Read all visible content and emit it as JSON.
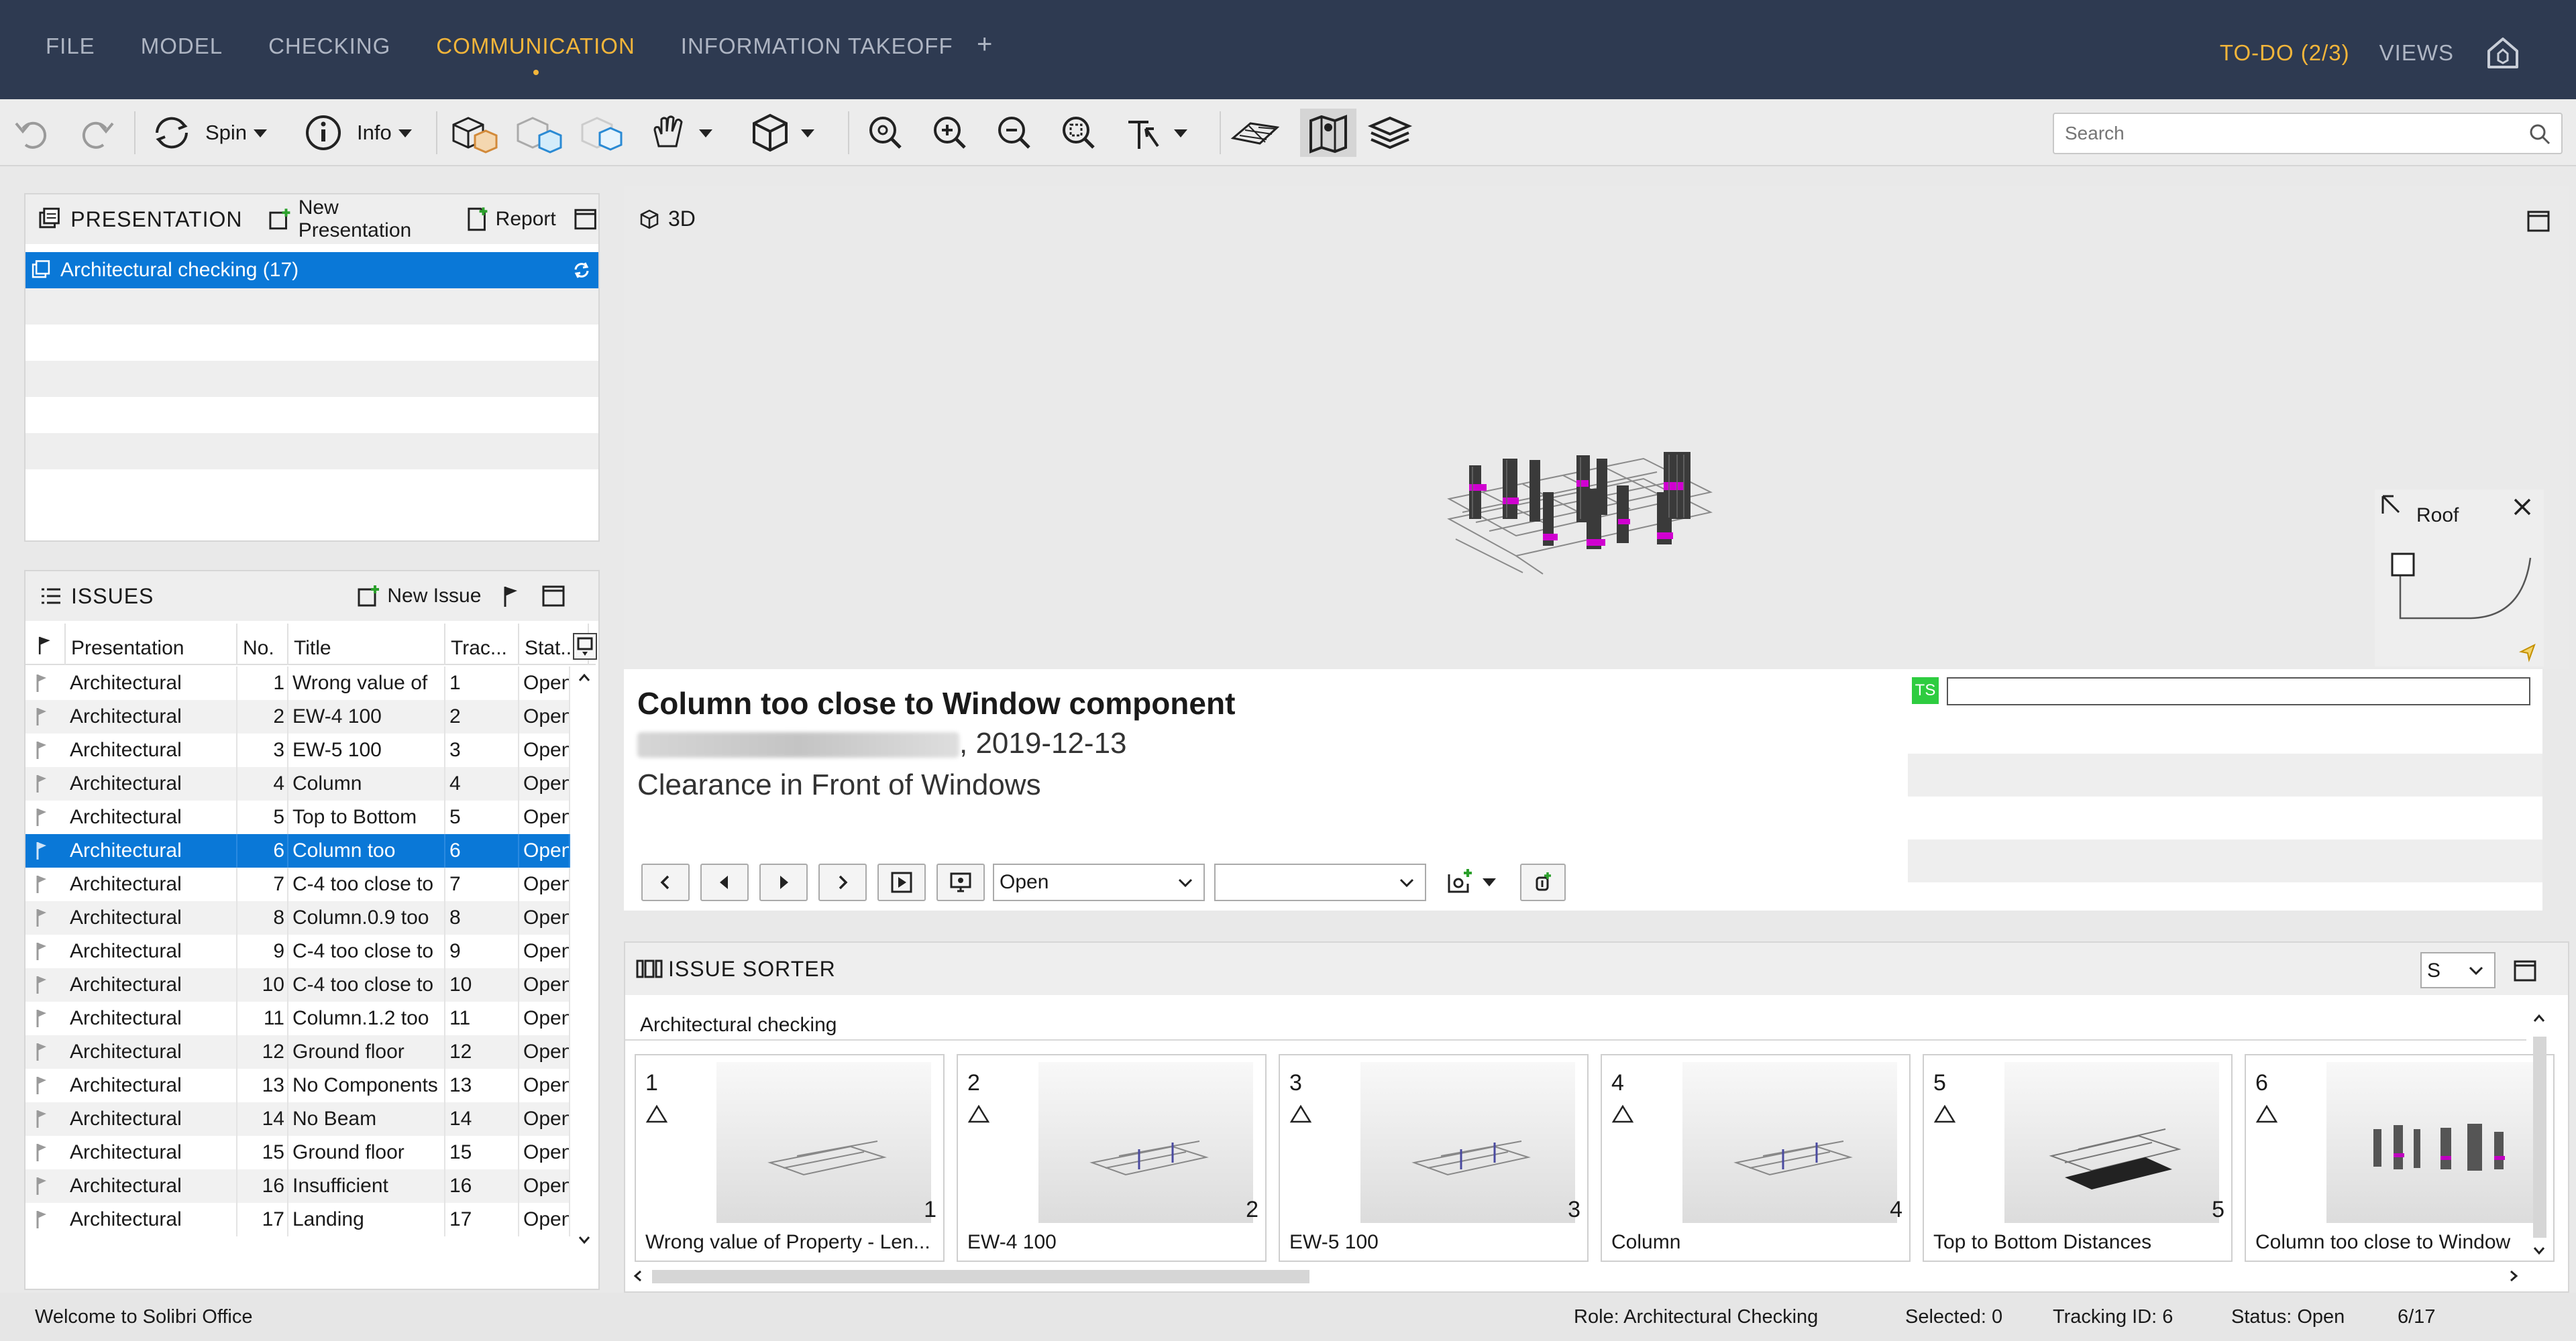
{
  "menu": {
    "items": [
      {
        "label": "FILE",
        "active": false
      },
      {
        "label": "MODEL",
        "active": false
      },
      {
        "label": "CHECKING",
        "active": false
      },
      {
        "label": "COMMUNICATION",
        "active": true
      },
      {
        "label": "INFORMATION TAKEOFF",
        "active": false
      }
    ],
    "plus": "+",
    "todo": "TO-DO (2/3)",
    "views": "VIEWS"
  },
  "toolbar": {
    "spin_label": "Spin",
    "info_label": "Info",
    "search_placeholder": "Search"
  },
  "presentation": {
    "title": "PRESENTATION",
    "new_label": "New Presentation",
    "report_label": "Report",
    "selected_item": "Architectural checking (17)"
  },
  "issues": {
    "title": "ISSUES",
    "new_label": "New Issue",
    "columns": [
      "Presentation",
      "No.",
      "Title",
      "Trac...",
      "Stat..."
    ],
    "rows": [
      {
        "presentation": "Architectural",
        "no": "1",
        "title": "Wrong value of",
        "tracking": "1",
        "status": "Open"
      },
      {
        "presentation": "Architectural",
        "no": "2",
        "title": "EW-4 100",
        "tracking": "2",
        "status": "Open"
      },
      {
        "presentation": "Architectural",
        "no": "3",
        "title": "EW-5 100",
        "tracking": "3",
        "status": "Open"
      },
      {
        "presentation": "Architectural",
        "no": "4",
        "title": "Column",
        "tracking": "4",
        "status": "Open"
      },
      {
        "presentation": "Architectural",
        "no": "5",
        "title": "Top to Bottom",
        "tracking": "5",
        "status": "Open"
      },
      {
        "presentation": "Architectural",
        "no": "6",
        "title": "Column too",
        "tracking": "6",
        "status": "Open"
      },
      {
        "presentation": "Architectural",
        "no": "7",
        "title": "C-4 too close to",
        "tracking": "7",
        "status": "Open"
      },
      {
        "presentation": "Architectural",
        "no": "8",
        "title": "Column.0.9 too",
        "tracking": "8",
        "status": "Open"
      },
      {
        "presentation": "Architectural",
        "no": "9",
        "title": "C-4 too close to",
        "tracking": "9",
        "status": "Open"
      },
      {
        "presentation": "Architectural",
        "no": "10",
        "title": "C-4 too close to",
        "tracking": "10",
        "status": "Open"
      },
      {
        "presentation": "Architectural",
        "no": "11",
        "title": "Column.1.2 too",
        "tracking": "11",
        "status": "Open"
      },
      {
        "presentation": "Architectural",
        "no": "12",
        "title": "Ground floor",
        "tracking": "12",
        "status": "Open"
      },
      {
        "presentation": "Architectural",
        "no": "13",
        "title": "No Components",
        "tracking": "13",
        "status": "Open"
      },
      {
        "presentation": "Architectural",
        "no": "14",
        "title": "No Beam",
        "tracking": "14",
        "status": "Open"
      },
      {
        "presentation": "Architectural",
        "no": "15",
        "title": "Ground floor",
        "tracking": "15",
        "status": "Open"
      },
      {
        "presentation": "Architectural",
        "no": "16",
        "title": "Insufficient",
        "tracking": "16",
        "status": "Open"
      },
      {
        "presentation": "Architectural",
        "no": "17",
        "title": "Landing",
        "tracking": "17",
        "status": "Open"
      }
    ],
    "selected_index": 5
  },
  "view3d": {
    "title": "3D",
    "floor_label": "Roof"
  },
  "detail": {
    "title": "Column too close to Window component",
    "meta": ", 2019-12-13",
    "description": "Clearance in Front of Windows",
    "status_value": "Open",
    "assignee_value": "",
    "ts_badge": "TS"
  },
  "sorter": {
    "title": "ISSUE SORTER",
    "size_value": "S",
    "group_label": "Architectural checking",
    "cards": [
      {
        "num": "1",
        "idx": "1",
        "label": "Wrong value of Property - Len..."
      },
      {
        "num": "2",
        "idx": "2",
        "label": "EW-4 100"
      },
      {
        "num": "3",
        "idx": "3",
        "label": "EW-5 100"
      },
      {
        "num": "4",
        "idx": "4",
        "label": "Column"
      },
      {
        "num": "5",
        "idx": "5",
        "label": "Top to Bottom Distances"
      },
      {
        "num": "6",
        "idx": "",
        "label": "Column too close to Window"
      }
    ]
  },
  "status": {
    "welcome": "Welcome to Solibri Office",
    "role": "Role: Architectural Checking",
    "selected": "Selected: 0",
    "tracking": "Tracking ID: 6",
    "status": "Status: Open",
    "position": "6/17"
  },
  "colors": {
    "menubar_bg": "#2e3a51",
    "accent": "#f3b53a",
    "selection": "#0a78d7",
    "ts_badge": "#2ecc40"
  }
}
